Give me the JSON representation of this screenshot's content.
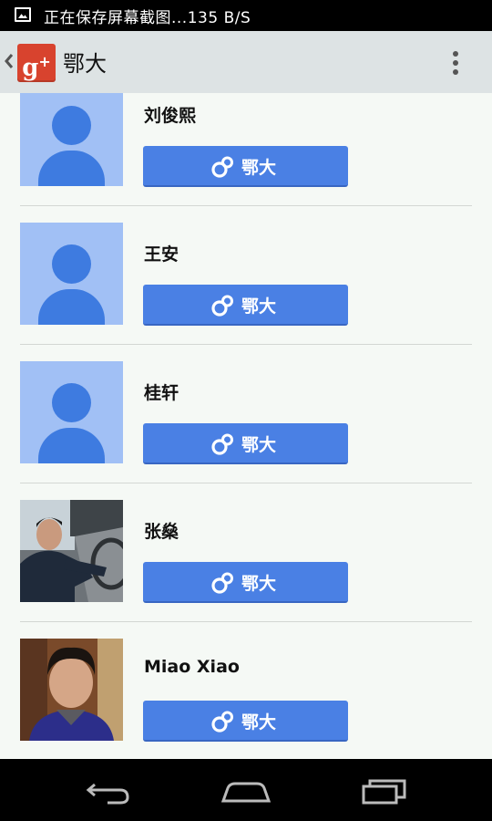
{
  "status_bar": {
    "text": "正在保存屏幕截图...135 B/S"
  },
  "app_bar": {
    "logo_text": "g",
    "logo_sup": "+",
    "title": "鄂大"
  },
  "contacts": [
    {
      "name": "刘俊熙",
      "avatar": "default",
      "button_label": "鄂大",
      "button_icon": "circles-icon"
    },
    {
      "name": "王安",
      "avatar": "default",
      "button_label": "鄂大",
      "button_icon": "circles-icon"
    },
    {
      "name": "桂轩",
      "avatar": "default",
      "button_label": "鄂大",
      "button_icon": "circles-icon"
    },
    {
      "name": "张燊",
      "avatar": "photo",
      "button_label": "鄂大",
      "button_icon": "circles-icon"
    },
    {
      "name": "Miao Xiao",
      "avatar": "photo",
      "button_label": "鄂大",
      "button_icon": "circles-icon"
    }
  ],
  "nav_bar": {
    "icons": [
      "back-icon",
      "home-icon",
      "recents-icon"
    ]
  },
  "colors": {
    "accent": "#4a80e4",
    "avatar_bg": "#a1c0f5",
    "avatar_fg": "#3e7be0",
    "app_bar": "#dde3e4",
    "logo": "#d8432e"
  }
}
